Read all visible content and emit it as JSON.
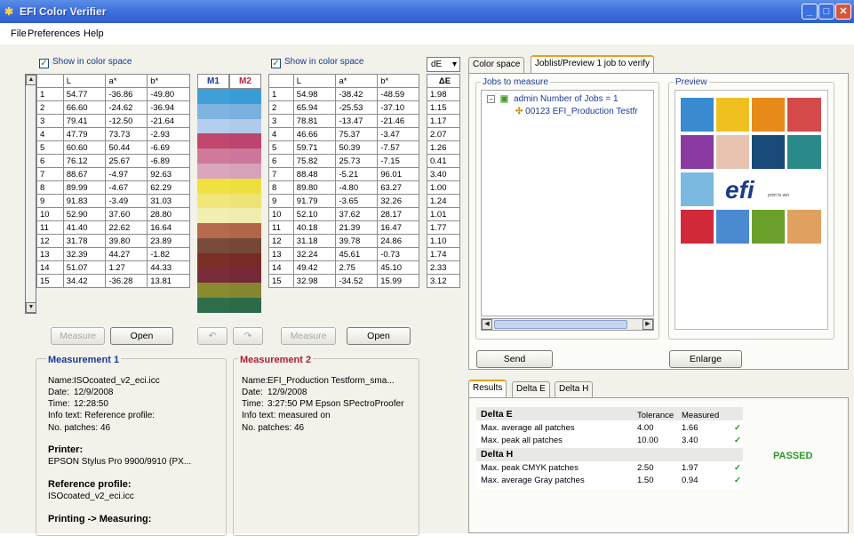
{
  "window": {
    "title": "EFI Color Verifier"
  },
  "menu": [
    "File",
    "Preferences",
    "Help"
  ],
  "left": {
    "show_label": "Show in color space",
    "columns": [
      "",
      "L",
      "a*",
      "b*"
    ],
    "rows": [
      [
        "1",
        "54.77",
        "-36.86",
        "-49.80"
      ],
      [
        "2",
        "66.60",
        "-24.62",
        "-36.94"
      ],
      [
        "3",
        "79.41",
        "-12.50",
        "-21.64"
      ],
      [
        "4",
        "47.79",
        "73.73",
        "-2.93"
      ],
      [
        "5",
        "60.60",
        "50.44",
        "-6.69"
      ],
      [
        "6",
        "76.12",
        "25.67",
        "-6.89"
      ],
      [
        "7",
        "88.67",
        "-4.97",
        "92.63"
      ],
      [
        "8",
        "89.99",
        "-4.67",
        "62.29"
      ],
      [
        "9",
        "91.83",
        "-3.49",
        "31.03"
      ],
      [
        "10",
        "52.90",
        "37.60",
        "28.80"
      ],
      [
        "11",
        "41.40",
        "22.62",
        "16.64"
      ],
      [
        "12",
        "31.78",
        "39.80",
        "23.89"
      ],
      [
        "13",
        "32.39",
        "44.27",
        "-1.82"
      ],
      [
        "14",
        "51.07",
        "1.27",
        "44.33"
      ],
      [
        "15",
        "34.42",
        "-36.28",
        "13.81"
      ]
    ],
    "measure_label": "Measure",
    "open_label": "Open"
  },
  "swatches": {
    "m1_label": "M1",
    "m2_label": "M2",
    "m1_colors": [
      "#3fa0d8",
      "#7fb4e0",
      "#b4cfee",
      "#c2476f",
      "#cf7a9a",
      "#d9a6bd",
      "#f0e040",
      "#f0e67a",
      "#f1eeb0",
      "#b66a4c",
      "#7a4a3a",
      "#7a3026",
      "#7a2c3a",
      "#8a8a30",
      "#2f6e4a"
    ],
    "m2_colors": [
      "#3a9cd6",
      "#7ab0de",
      "#b0cbea",
      "#be4470",
      "#cb769a",
      "#d6a2ba",
      "#eee03c",
      "#eee476",
      "#efecae",
      "#b26648",
      "#764636",
      "#762c24",
      "#762838",
      "#868630",
      "#2c6a48"
    ],
    "undo_icon": "undo-icon",
    "redo_icon": "redo-icon"
  },
  "right": {
    "show_label": "Show in color space",
    "columns": [
      "",
      "L",
      "a*",
      "b*"
    ],
    "rows": [
      [
        "1",
        "54.98",
        "-38.42",
        "-48.59"
      ],
      [
        "2",
        "65.94",
        "-25.53",
        "-37.10"
      ],
      [
        "3",
        "78.81",
        "-13.47",
        "-21.46"
      ],
      [
        "4",
        "46.66",
        "75.37",
        "-3.47"
      ],
      [
        "5",
        "59.71",
        "50.39",
        "-7.57"
      ],
      [
        "6",
        "75.82",
        "25.73",
        "-7.15"
      ],
      [
        "7",
        "88.48",
        "-5.21",
        "96.01"
      ],
      [
        "8",
        "89.80",
        "-4.80",
        "63.27"
      ],
      [
        "9",
        "91.79",
        "-3.65",
        "32.26"
      ],
      [
        "10",
        "52.10",
        "37.62",
        "28.17"
      ],
      [
        "11",
        "40.18",
        "21.39",
        "16.47"
      ],
      [
        "12",
        "31.18",
        "39.78",
        "24.86"
      ],
      [
        "13",
        "32.24",
        "45.61",
        "-0.73"
      ],
      [
        "14",
        "49.42",
        "2.75",
        "45.10"
      ],
      [
        "15",
        "32.98",
        "-34.52",
        "15.99"
      ]
    ],
    "measure_label": "Measure",
    "open_label": "Open"
  },
  "de": {
    "dropdown": "dE",
    "header": "ΔE",
    "values": [
      "1.98",
      "1.15",
      "1.17",
      "2.07",
      "1.26",
      "0.41",
      "3.40",
      "1.00",
      "1.24",
      "1.01",
      "1.77",
      "1.10",
      "1.74",
      "2.33",
      "3.12"
    ]
  },
  "measurement1": {
    "title": "Measurement 1",
    "name_label": "Name:",
    "name": "ISOcoated_v2_eci.icc",
    "date_label": "Date:",
    "date": "12/9/2008",
    "time_label": "Time:",
    "time": "12:28:50",
    "info_label": "Info text:",
    "info": "Reference profile:",
    "patches_label": "No. patches:",
    "patches": "46",
    "printer_title": "Printer:",
    "printer": "EPSON Stylus Pro 9900/9910 (PX...",
    "ref_title": "Reference profile:",
    "ref": "ISOcoated_v2_eci.icc",
    "printing_title": "Printing -> Measuring:"
  },
  "measurement2": {
    "title": "Measurement 2",
    "name_label": "Name:",
    "name": "EFI_Production Testform_sma...",
    "date_label": "Date:",
    "date": "12/9/2008",
    "time_label": "Time:",
    "time": "3:27:50 PM Epson SPectroProofer",
    "info_label": "Info text:",
    "info": "measured on",
    "patches_label": "No. patches:",
    "patches": "46"
  },
  "tabs_top": [
    "Color space",
    "Joblist/Preview  1 job to verify"
  ],
  "jobs": {
    "title": "Jobs to measure",
    "root": "admin  Number of Jobs = 1",
    "child": "00123 EFI_Production Testfr"
  },
  "preview": {
    "title": "Preview",
    "logo": "efi",
    "tagline": "print to win"
  },
  "send_label": "Send",
  "enlarge_label": "Enlarge",
  "tabs_results": [
    "Results",
    "Delta E",
    "Delta H"
  ],
  "results": {
    "deltaE_title": "Delta E",
    "tolerance_header": "Tolerance",
    "measured_header": "Measured",
    "rows_e": [
      {
        "label": "Max. average all patches",
        "tol": "4.00",
        "meas": "1.66",
        "ok": "✓"
      },
      {
        "label": "Max. peak all patches",
        "tol": "10.00",
        "meas": "3.40",
        "ok": "✓"
      }
    ],
    "deltaH_title": "Delta H",
    "rows_h": [
      {
        "label": "Max. peak CMYK patches",
        "tol": "2.50",
        "meas": "1.97",
        "ok": "✓"
      },
      {
        "label": "Max. average Gray patches",
        "tol": "1.50",
        "meas": "0.94",
        "ok": "✓"
      }
    ],
    "status": "PASSED",
    "status_color": "#2a9a2a"
  }
}
